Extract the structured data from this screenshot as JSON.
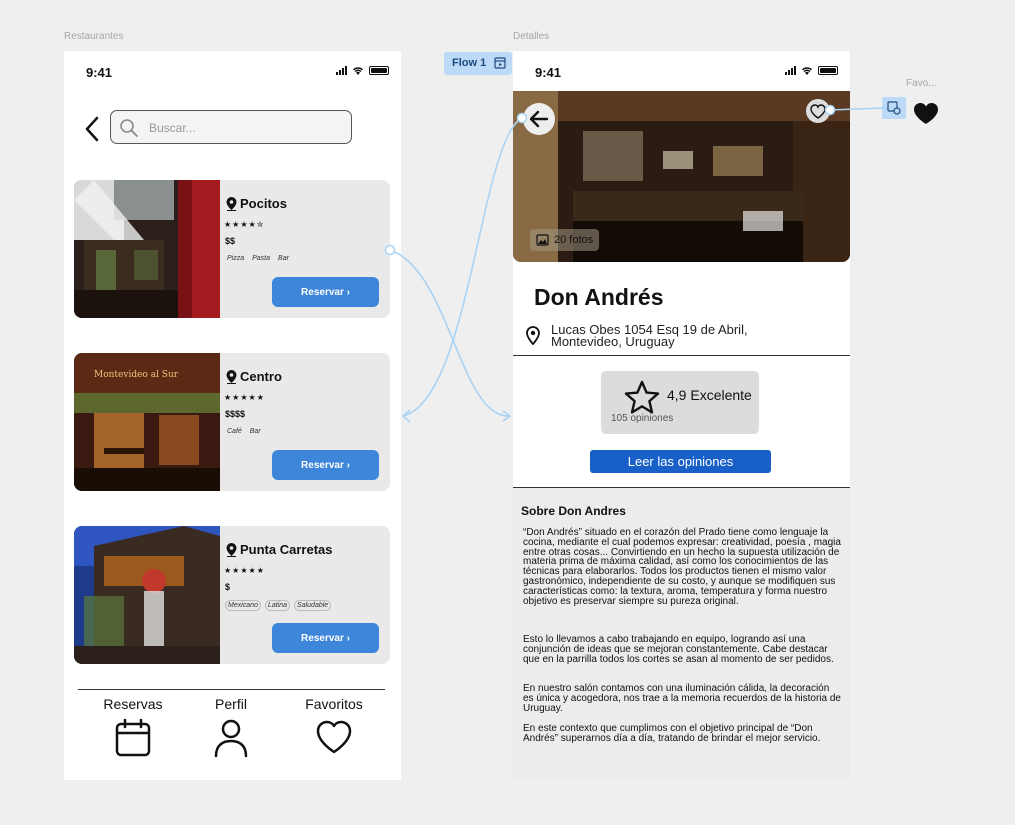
{
  "canvas": {
    "left_frame_label": "Restaurantes",
    "right_frame_label": "Detalles",
    "flow_label": "Flow 1",
    "fav_frame_label": "Favo..."
  },
  "status_bar": {
    "time": "9:41"
  },
  "restaurantes": {
    "search": {
      "placeholder": "Buscar..."
    },
    "cards": [
      {
        "location": "Pocitos",
        "stars": "★★★★✮",
        "price": "$$",
        "tags": [
          "Pizza",
          "Pasta",
          "Bar"
        ],
        "button": "Reservar ›"
      },
      {
        "location": "Centro",
        "stars": "★★★★★",
        "price": "$$$$",
        "tags": [
          "Café",
          "Bar"
        ],
        "button": "Reservar ›"
      },
      {
        "location": "Punta Carretas",
        "stars": "★★★★★",
        "price": "$",
        "tags": [
          "Mexicano",
          "Latina",
          "Saludable"
        ],
        "button": "Reservar ›"
      }
    ],
    "tabbar": [
      {
        "label": "Reservas",
        "icon": "calendar-icon"
      },
      {
        "label": "Perfil",
        "icon": "user-icon"
      },
      {
        "label": "Favoritos",
        "icon": "heart-icon"
      }
    ]
  },
  "detalles": {
    "photo_count": "20 fotos",
    "name": "Don Andrés",
    "address_line1": "Lucas Obes 1054 Esq 19 de Abril,",
    "address_line2": "Montevideo, Uruguay",
    "rating": {
      "score": "4,9 Excelente",
      "count": "105 opiniones"
    },
    "read_reviews": "Leer las opiniones",
    "about": {
      "title": "Sobre Don Andres",
      "paragraphs": [
        "“Don Andrés” situado en el corazón del Prado tiene como lenguaje la cocina, mediante el cual podemos expresar: creatividad, poesía , magia entre otras cosas... Convirtiendo en un hecho la supuesta utilización de materia prima de máxima calidad, así como los conocimientos de las técnicas para elaborarlos. Todos los productos tienen el mismo valor gastronómico, independiente de su costo, y aunque se modifiquen sus características como: la textura, aroma, temperatura y forma nuestro objetivo es preservar siempre su pureza original.",
        "Esto lo llevamos a cabo trabajando en equipo, logrando así una conjunción de ideas que se mejoran constantemente. Cabe destacar que en la parrilla todos los cortes se asan al momento de ser pedidos.",
        "En nuestro salón contamos con una iluminación cálida, la decoración es única y acogedora, nos trae a la memoria recuerdos de la historia de Uruguay.",
        "En este contexto que cumplimos con el objetivo principal de “Don Andrés” superarnos día a día, tratando de brindar el mejor servicio."
      ]
    }
  },
  "colors": {
    "accent": "#3d86d9",
    "primary_button": "#1860c8",
    "flow_tag": "#bcdaf7",
    "connector": "#a9d3f5"
  }
}
